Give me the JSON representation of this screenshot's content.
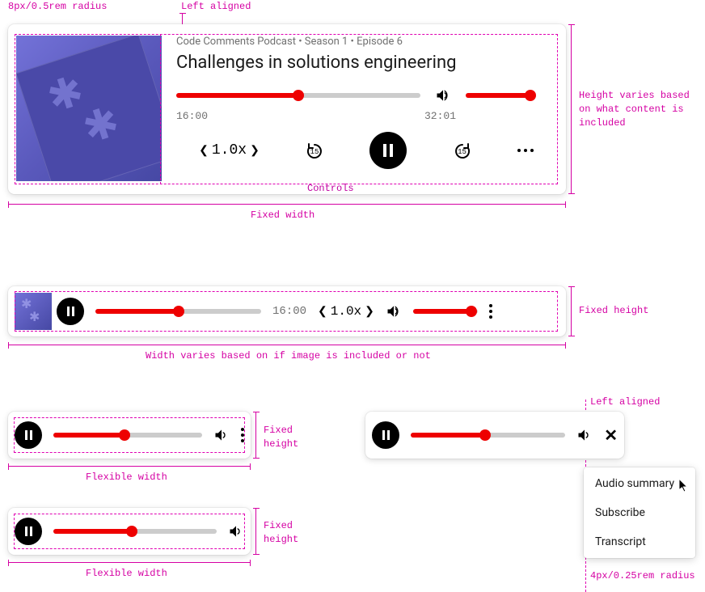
{
  "annotations": {
    "radius8": "8px/0.5rem radius",
    "left_aligned": "Left aligned",
    "height_varies": "Height varies based\non what content is\nincluded",
    "fixed_width": "Fixed width",
    "controls": "Controls",
    "fixed_height": "Fixed height",
    "width_varies": "Width varies based on if image is included or not",
    "fixed_height2": "Fixed\nheight",
    "flexible_width": "Flexible width",
    "fixed_height3": "Fixed\nheight",
    "flexible_width2": "Flexible width",
    "left_aligned2": "Left aligned",
    "radius4": "4px/0.25rem radius"
  },
  "player1": {
    "meta": "Code Comments Podcast • Season 1 • Episode 6",
    "title": "Challenges in solutions engineering",
    "seek_pct": 50,
    "vol_pct": 100,
    "elapsed": "16:00",
    "total": "32:01",
    "speed": "1.0x",
    "skip_back": "15",
    "skip_fwd": "15"
  },
  "player2": {
    "seek_pct": 50,
    "time": "16:00",
    "speed": "1.0x",
    "vol_pct": 90
  },
  "player3": {
    "seek_pct": 48
  },
  "player4": {
    "seek_pct": 48
  },
  "player5": {
    "seek_pct": 48
  },
  "menu": {
    "items": [
      "Audio summary",
      "Subscribe",
      "Transcript"
    ]
  }
}
